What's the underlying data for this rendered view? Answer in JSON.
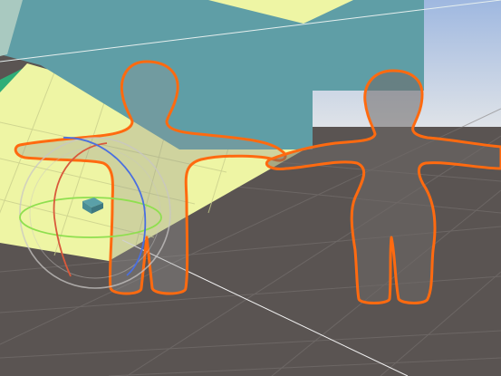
{
  "viewport": {
    "colors": {
      "floor": "#5a5452",
      "sky_top": "#9fb8e0",
      "sky_horizon": "#dfe3e8",
      "teal_wall": "#5f9ea6",
      "teal_wall_shadow": "#4e8a92",
      "yellow_plane": "#eef5a4",
      "green_strip": "#2fae78",
      "selection_outline": "#ff6a10",
      "grid_line": "#7b7674",
      "gizmo_red": "#d9593b",
      "gizmo_green": "#8fdf4f",
      "gizmo_blue": "#4a6fe0",
      "gizmo_sphere": "#c8c6c4",
      "gizmo_handle": "#5aa0a8"
    },
    "objects": [
      {
        "name": "teal-wall",
        "icon": "none"
      },
      {
        "name": "yellow-plane",
        "icon": "none"
      },
      {
        "name": "character-left-selected",
        "icon": "none"
      },
      {
        "name": "character-right-selected",
        "icon": "none"
      },
      {
        "name": "rotation-gizmo",
        "icon": "rotate-gizmo-icon"
      }
    ]
  }
}
